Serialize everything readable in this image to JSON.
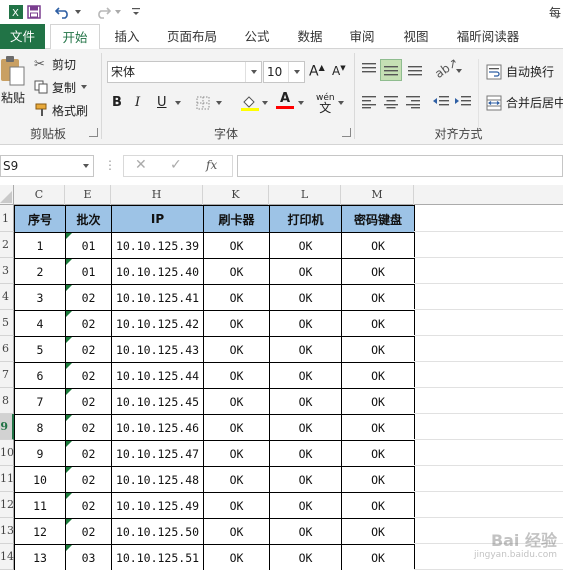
{
  "window": {
    "title": "每"
  },
  "tabs": [
    "文件",
    "开始",
    "插入",
    "页面布局",
    "公式",
    "数据",
    "审阅",
    "视图",
    "福昕阅读器"
  ],
  "clipboard": {
    "paste": "粘贴",
    "cut": "剪切",
    "copy": "复制",
    "format_painter": "格式刷",
    "group": "剪贴板"
  },
  "font": {
    "name": "宋体",
    "size": "10",
    "bold": "B",
    "italic": "I",
    "underline": "U",
    "font_color_glyph": "A",
    "phonetic": "wén",
    "group": "字体"
  },
  "alignment": {
    "wrap": "自动换行",
    "merge": "合并后居中",
    "group": "对齐方式"
  },
  "formula_bar": {
    "name_box": "S9",
    "fx": "fx",
    "value": ""
  },
  "columns": [
    "C",
    "E",
    "H",
    "K",
    "L",
    "M"
  ],
  "row_numbers": [
    "1",
    "2",
    "3",
    "4",
    "5",
    "6",
    "7",
    "8",
    "9",
    "10",
    "11",
    "12",
    "13",
    "14"
  ],
  "selected_row": "9",
  "table": {
    "headers": [
      "序号",
      "批次",
      "IP",
      "刷卡器",
      "打印机",
      "密码键盘"
    ],
    "rows": [
      [
        "1",
        "01",
        "10.10.125.39",
        "OK",
        "OK",
        "OK"
      ],
      [
        "2",
        "01",
        "10.10.125.40",
        "OK",
        "OK",
        "OK"
      ],
      [
        "3",
        "02",
        "10.10.125.41",
        "OK",
        "OK",
        "OK"
      ],
      [
        "4",
        "02",
        "10.10.125.42",
        "OK",
        "OK",
        "OK"
      ],
      [
        "5",
        "02",
        "10.10.125.43",
        "OK",
        "OK",
        "OK"
      ],
      [
        "6",
        "02",
        "10.10.125.44",
        "OK",
        "OK",
        "OK"
      ],
      [
        "7",
        "02",
        "10.10.125.45",
        "OK",
        "OK",
        "OK"
      ],
      [
        "8",
        "02",
        "10.10.125.46",
        "OK",
        "OK",
        "OK"
      ],
      [
        "9",
        "02",
        "10.10.125.47",
        "OK",
        "OK",
        "OK"
      ],
      [
        "10",
        "02",
        "10.10.125.48",
        "OK",
        "OK",
        "OK"
      ],
      [
        "11",
        "02",
        "10.10.125.49",
        "OK",
        "OK",
        "OK"
      ],
      [
        "12",
        "02",
        "10.10.125.50",
        "OK",
        "OK",
        "OK"
      ],
      [
        "13",
        "03",
        "10.10.125.51",
        "OK",
        "OK",
        "OK"
      ]
    ]
  },
  "watermark": {
    "text": "Bai 经验",
    "sub": "jingyan.baidu.com"
  },
  "colors": {
    "excel_green": "#217346",
    "header_fill": "#9dc3e6",
    "fill_yellow": "#ffff00",
    "font_red": "#ff0000"
  }
}
